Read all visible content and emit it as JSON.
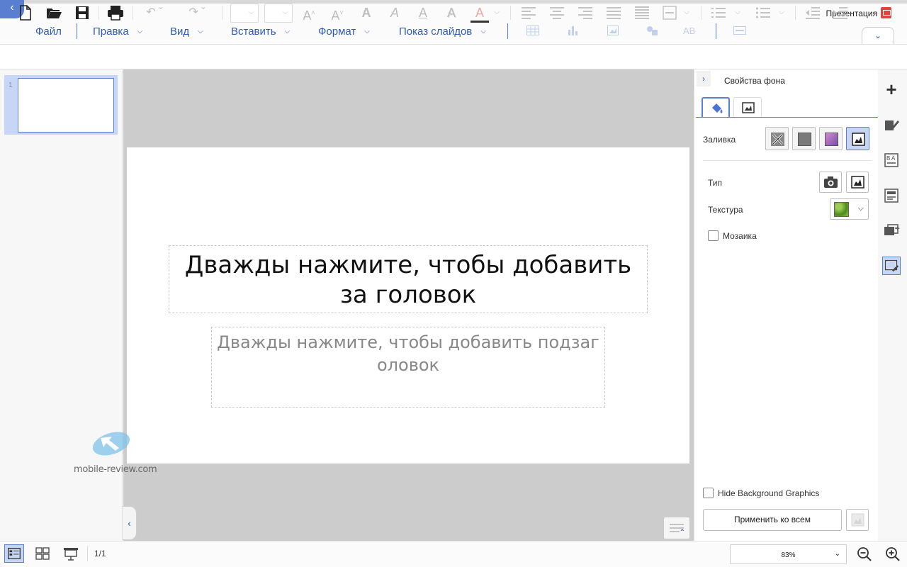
{
  "app": {
    "doc_title": "Презентация"
  },
  "menu": {
    "file": "Файл",
    "edit": "Правка",
    "view": "Вид",
    "insert": "Вставить",
    "format": "Формат",
    "slideshow": "Показ слайдов"
  },
  "slide": {
    "title_placeholder": "Дважды нажмите, чтобы добавить за головок",
    "subtitle_placeholder": "Дважды нажмите, чтобы добавить подзаг оловок"
  },
  "thumbnails": [
    {
      "number": "1"
    }
  ],
  "props": {
    "title": "Свойства фона",
    "fill_label": "Заливка",
    "type_label": "Тип",
    "texture_label": "Текстура",
    "mosaic_label": "Мозаика",
    "mosaic_checked": false,
    "hide_bg_label": "Hide Background Graphics",
    "hide_bg_checked": false,
    "apply_all_label": "Применить ко всем",
    "selected_fill": "picture-texture"
  },
  "status": {
    "page_indicator": "1/1",
    "zoom": "83%"
  },
  "watermark": {
    "text": "mobile-review.com"
  },
  "colors": {
    "accent": "#5a7ed0",
    "menu_text": "#2f5bb5",
    "selection": "#c7d6f4",
    "canvas_bg": "#cccccc",
    "doc_icon": "#e2433d"
  }
}
